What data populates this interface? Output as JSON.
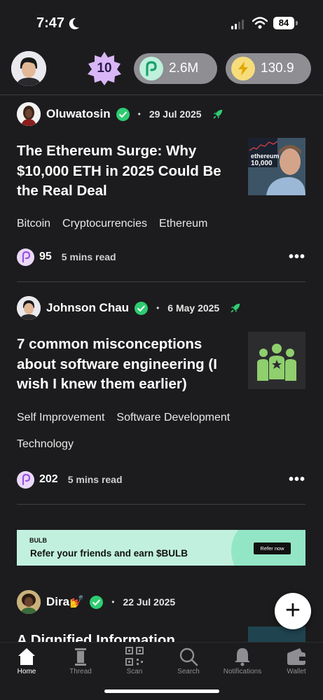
{
  "status_bar": {
    "time": "7:47",
    "battery": "84"
  },
  "header": {
    "level": "10",
    "bulb_balance": "2.6M",
    "energy_balance": "130.9"
  },
  "articles": [
    {
      "author": "Oluwatosin",
      "date": "29 Jul 2025",
      "title": "The Ethereum Surge: Why $10,000 ETH in 2025 Could Be the Real Deal",
      "tags": [
        "Bitcoin",
        "Cryptocurrencies",
        "Ethereum"
      ],
      "claps": "95",
      "read_time": "5 mins read",
      "thumb_text": "ethereum\n10,000"
    },
    {
      "author": "Johnson Chau",
      "date": "6 May 2025",
      "title": "7 common misconceptions about software engineering (I wish I knew them earlier)",
      "tags": [
        "Self Improvement",
        "Software Development",
        "Technology"
      ],
      "claps": "202",
      "read_time": "5 mins read"
    },
    {
      "author": "Dira💅",
      "date": "22 Jul 2025",
      "title": "A Dignified Information"
    }
  ],
  "banner": {
    "brand": "BULB",
    "text": "Refer your friends and earn $BULB",
    "button": "Refer now"
  },
  "separator": "•",
  "more_label": "•••",
  "fab_label": "+",
  "tabs": [
    {
      "label": "Home",
      "icon": "home-icon"
    },
    {
      "label": "Thread",
      "icon": "thread-icon"
    },
    {
      "label": "Scan",
      "icon": "qr-scan-icon"
    },
    {
      "label": "Search",
      "icon": "search-icon"
    },
    {
      "label": "Notifications",
      "icon": "bell-icon"
    },
    {
      "label": "Wallet",
      "icon": "wallet-icon"
    }
  ],
  "colors": {
    "verified": "#2ecc71",
    "accent_mint": "#c1f1de",
    "coin": "#e9d8f7"
  }
}
